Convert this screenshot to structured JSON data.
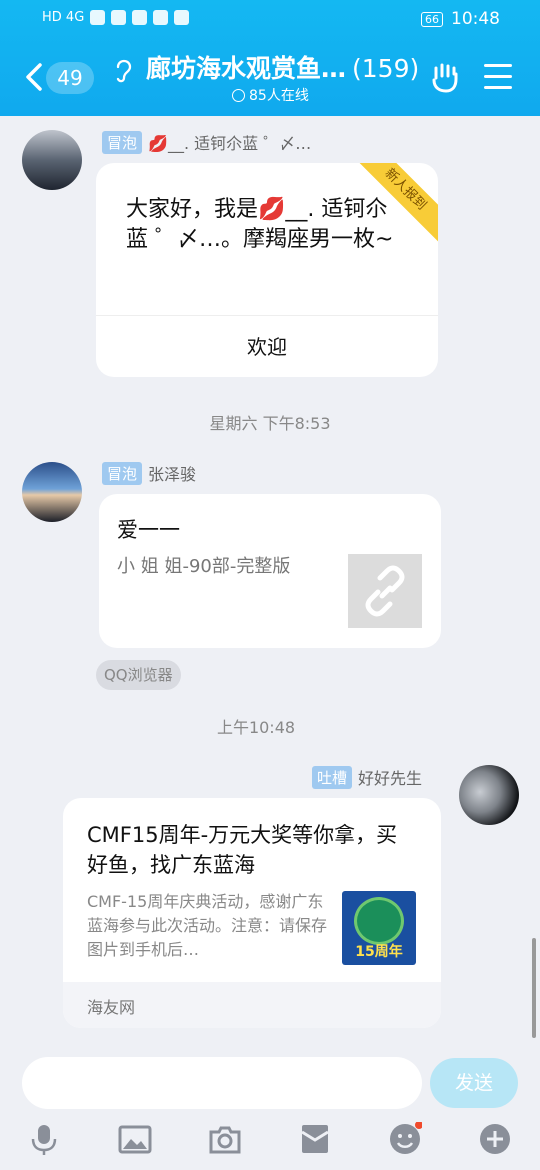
{
  "status_bar": {
    "left_text": "HD 4G",
    "time": "10:48",
    "battery": "66"
  },
  "header": {
    "unread_badge": "49",
    "group_name": "廊坊海水观赏鱼…",
    "member_count": "(159)",
    "online_text": "85人在线"
  },
  "messages": [
    {
      "tag": "冒泡",
      "sender": "💋__. 适钶尒蓝 ゜〆…",
      "ribbon": "新人报到",
      "text": "大家好，我是💋__. 适钶尒蓝 ゜〆…。摩羯座男一枚~",
      "action": "欢迎"
    },
    {
      "time": "星期六 下午8:53"
    },
    {
      "tag": "冒泡",
      "sender": "张泽骏",
      "title": "爱一一",
      "desc": "小 姐 姐-90部-完整版",
      "source": "QQ浏览器"
    },
    {
      "time": "上午10:48"
    },
    {
      "tag": "吐槽",
      "sender": "好好先生",
      "title": "CMF15周年-万元大奖等你拿，买好鱼，找广东蓝海",
      "desc": "CMF-15周年庆典活动，感谢广东蓝海参与此次活动。注意：请保存图片到手机后…",
      "thumb_label": "15周年",
      "source": "海友网"
    }
  ],
  "input": {
    "placeholder": "",
    "send_label": "发送"
  },
  "toolbar": {
    "icons": [
      "microphone-icon",
      "image-icon",
      "camera-icon",
      "red-packet-icon",
      "emoji-icon",
      "plus-icon"
    ]
  },
  "colors": {
    "header": "#10a9ee",
    "tag": "#9fc9f0",
    "ribbon": "#f8cc37"
  }
}
